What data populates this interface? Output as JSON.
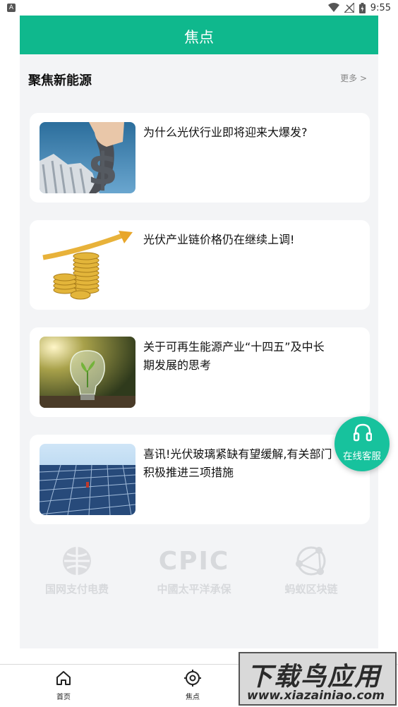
{
  "status_bar": {
    "app_badge": "A",
    "time": "9:55",
    "icons": [
      "wifi-icon",
      "no-signal-icon",
      "battery-icon"
    ]
  },
  "header": {
    "title": "焦点"
  },
  "section": {
    "title": "聚焦新能源",
    "more_label": "更多 >"
  },
  "articles": [
    {
      "headline": "为什么光伏行业即将迎来大爆发?",
      "thumb": "dollar-stairs"
    },
    {
      "headline": "光伏产业链价格仍在继续上调!",
      "thumb": "coins-arrow"
    },
    {
      "headline": "关于可再生能源产业“十四五”及中长期发展的思考",
      "thumb": "lightbulb-sprout"
    },
    {
      "headline": "喜讯!光伏玻璃紧缺有望缓解,有关部门积极推进三项措施",
      "thumb": "solar-panels"
    }
  ],
  "partners": [
    {
      "name": "国网支付电费",
      "logo": "state-grid-logo"
    },
    {
      "name": "中國太平洋承保",
      "logo_text": "CPIC"
    },
    {
      "name": "蚂蚁区块链",
      "logo": "ant-chain-logo"
    }
  ],
  "float_service": {
    "label": "在线客服",
    "icon": "headset-icon"
  },
  "tabs": [
    {
      "label": "首页",
      "icon": "home-icon"
    },
    {
      "label": "焦点",
      "icon": "focus-target-icon"
    }
  ],
  "watermark": {
    "title": "下载鸟应用",
    "url": "www.xiazainiao.com"
  },
  "colors": {
    "accent": "#0fb88d",
    "float_button": "#17c29d",
    "panel_bg": "#f3f4f6"
  }
}
